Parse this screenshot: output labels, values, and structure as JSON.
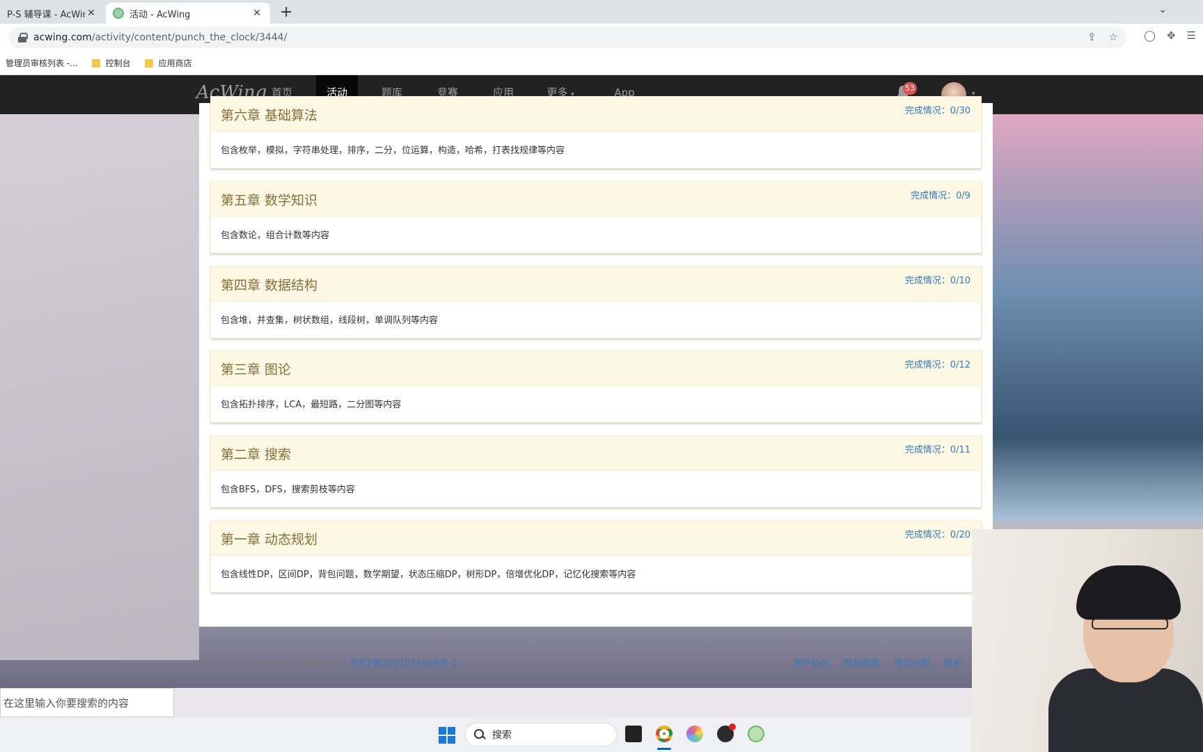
{
  "browser": {
    "tabs": [
      {
        "title": "P-S 辅导课 - AcWing",
        "active": false
      },
      {
        "title": "活动 - AcWing",
        "active": true
      }
    ],
    "url_host": "acwing.com",
    "url_path": "/activity/content/punch_the_clock/3444/",
    "bookmarks": [
      "管理员审核列表 -...",
      "控制台",
      "应用商店"
    ]
  },
  "navbar": {
    "logo": "AcWing",
    "links": [
      "首页",
      "活动",
      "题库",
      "竞赛",
      "应用",
      "更多",
      "App"
    ],
    "active_link": "活动",
    "notification_count": "53"
  },
  "chapters": [
    {
      "title": "第六章 基础算法",
      "status": "完成情况：0/30",
      "desc": "包含枚举，模拟，字符串处理，排序，二分，位运算，构造，哈希，打表找规律等内容"
    },
    {
      "title": "第五章 数学知识",
      "status": "完成情况：0/9",
      "desc": "包含数论，组合计数等内容"
    },
    {
      "title": "第四章 数据结构",
      "status": "完成情况：0/10",
      "desc": "包含堆，并查集，树状数组，线段树，单调队列等内容"
    },
    {
      "title": "第三章 图论",
      "status": "完成情况：0/12",
      "desc": "包含拓扑排序，LCA，最短路，二分图等内容"
    },
    {
      "title": "第二章 搜索",
      "status": "完成情况：0/11",
      "desc": "包含BFS，DFS，搜索剪枝等内容"
    },
    {
      "title": "第一章 动态规划",
      "status": "完成情况：0/20",
      "desc": "包含线性DP，区间DP，背包问题，数学期望，状态压缩DP，树形DP，倍增优化DP，记忆化搜索等内容"
    }
  ],
  "footer": {
    "copyright": "© 2018-2023 AcWing 版权所有 ｜",
    "icp": "京ICP备2021015969号-2",
    "links": [
      "用户协议",
      "隐私政策",
      "常见问题",
      "联系"
    ]
  },
  "search_placeholder": "在这里输入你要搜索的内容",
  "taskbar_search": "搜索"
}
